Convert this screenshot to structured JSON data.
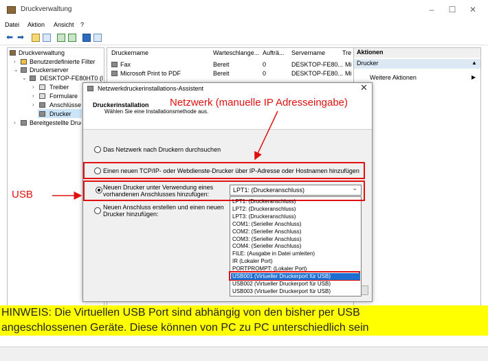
{
  "window": {
    "title": "Druckverwaltung",
    "minimize": "–",
    "maximize": "☐",
    "close": "✕"
  },
  "menu": [
    "Datei",
    "Aktion",
    "Ansicht",
    "?"
  ],
  "tree": {
    "items": [
      "Druckverwaltung",
      "Benutzerdefinierte Filter",
      "Druckerserver",
      "DESKTOP-FE80HT0 (lok",
      "Treiber",
      "Formulare",
      "Anschlüsse",
      "Drucker",
      "Bereitgestellte Druc"
    ]
  },
  "list": {
    "columns": [
      "Druckername",
      "Warteschlange...",
      "Aufträ...",
      "Servername",
      "Tre"
    ],
    "rows": [
      [
        "Fax",
        "Bereit",
        "0",
        "DESKTOP-FE80...",
        "Mi"
      ],
      [
        "Microsoft Print to PDF",
        "Bereit",
        "0",
        "DESKTOP-FE80...",
        "Mi"
      ]
    ]
  },
  "actions": {
    "header": "Aktionen",
    "section": "Drucker",
    "more": "Weitere Aktionen"
  },
  "dialog": {
    "title": "Netzwerkdruckerinstallations-Assistent",
    "close": "✕",
    "heading": "Druckerinstallation",
    "subheading": "Wählen Sie eine Installationsmethode aus.",
    "options": {
      "search_network": "Das Netzwerk nach Druckern durchsuchen",
      "tcpip": "Einen neuen TCP/IP- oder Webdienste-Drucker über IP-Adresse oder Hostnamen hinzufügen",
      "existing_port_line1": "Neuen Drucker unter Verwendung eines",
      "existing_port_line2": "vorhandenen Anschlusses hinzufügen:",
      "new_port_line1": "Neuen Anschluss erstellen und einen neuen",
      "new_port_line2": "Drucker hinzufügen:"
    },
    "port_select_value": "LPT1: (Druckeranschluss)",
    "port_options": [
      "LPT1: (Druckeranschluss)",
      "LPT2: (Druckeranschluss)",
      "LPT3: (Druckeranschluss)",
      "COM1: (Serieller Anschluss)",
      "COM2: (Serieller Anschluss)",
      "COM3: (Serieller Anschluss)",
      "COM4: (Serieller Anschluss)",
      "FILE: (Ausgabe in Datei umleiten)",
      "IR (Lokaler Port)",
      "PORTPROMPT: (Lokaler Port)",
      "USB001 (Virtueller Druckerport für USB)",
      "USB002 (Virtueller Druckerport für USB)",
      "USB003 (Virtueller Druckerport für USB)"
    ],
    "selected_port_index": 10
  },
  "annotations": {
    "network": "Netzwerk (manuelle IP Adresseingabe)",
    "usb": "USB",
    "note_line1": "HINWEIS: Die Virtuellen USB Port sind abhängig von den bisher per USB",
    "note_line2": "angeschlossenen Geräte. Diese können von PC zu PC unterschiedlich sein",
    "color_red": "#e01010",
    "color_highlight": "#ffff00"
  }
}
